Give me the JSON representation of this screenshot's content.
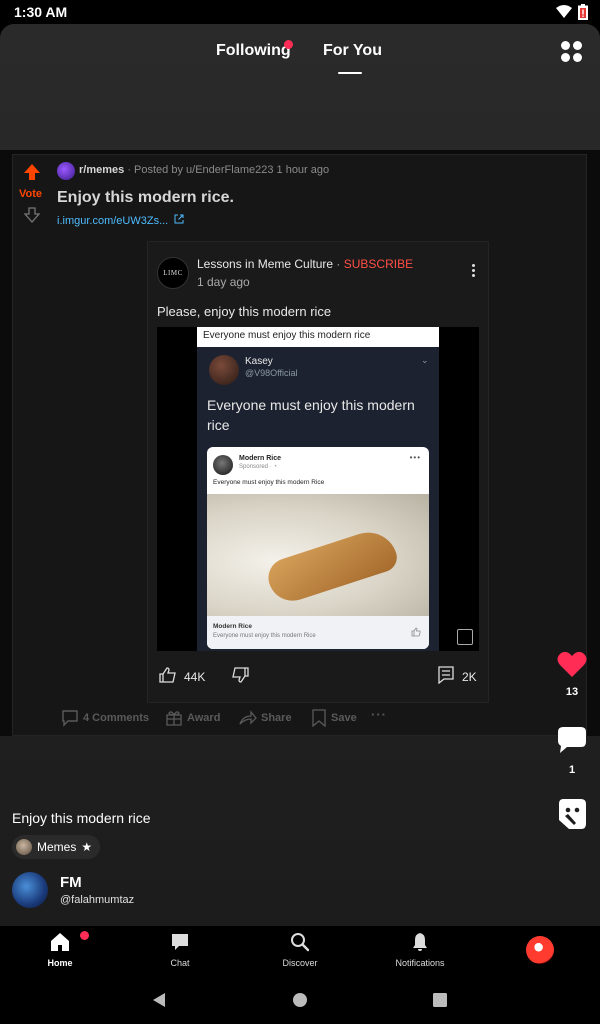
{
  "status": {
    "time": "1:30 AM"
  },
  "topnav": {
    "following": "Following",
    "for_you": "For You"
  },
  "reddit": {
    "vote_label": "Vote",
    "subreddit": "r/memes",
    "meta": "· Posted by u/EnderFlame223 1 hour ago",
    "title": "Enjoy this modern rice.",
    "link": "i.imgur.com/eUW3Zs...",
    "actions": {
      "comments": "4 Comments",
      "award": "Award",
      "share": "Share",
      "save": "Save",
      "more": "···"
    }
  },
  "youtube": {
    "channel_avatar_text": "LIMC",
    "channel": "Lessons in Meme Culture",
    "separator": "·",
    "subscribe": "SUBSCRIBE",
    "time": "1 day ago",
    "caption": "Please, enjoy this modern rice",
    "likes": "44K",
    "comments": "2K"
  },
  "meme": {
    "header": "Everyone must enjoy this modern rice",
    "tweet_name": "Kasey",
    "tweet_handle": "@V98Official",
    "tweet_text": "Everyone must enjoy this modern rice",
    "ad_title": "Modern Rice",
    "ad_sponsored": "Sponsored · ◔",
    "ad_text": "Everyone must enjoy this modern Rice",
    "ad_foot_title": "Modern Rice",
    "ad_foot_sub": "Everyone must enjoy this modern Rice"
  },
  "rail": {
    "likes": "13",
    "comments": "1"
  },
  "post": {
    "caption": "Enjoy this modern rice",
    "community": "Memes",
    "author_name": "FM",
    "author_handle": "@falahmumtaz"
  },
  "bottomnav": {
    "home": "Home",
    "chat": "Chat",
    "discover": "Discover",
    "notifications": "Notifications"
  },
  "colors": {
    "accent": "#ff2d55",
    "reddit_orange": "#ff4500",
    "link_blue": "#4fbcff",
    "subscribe_red": "#ff4e45"
  }
}
